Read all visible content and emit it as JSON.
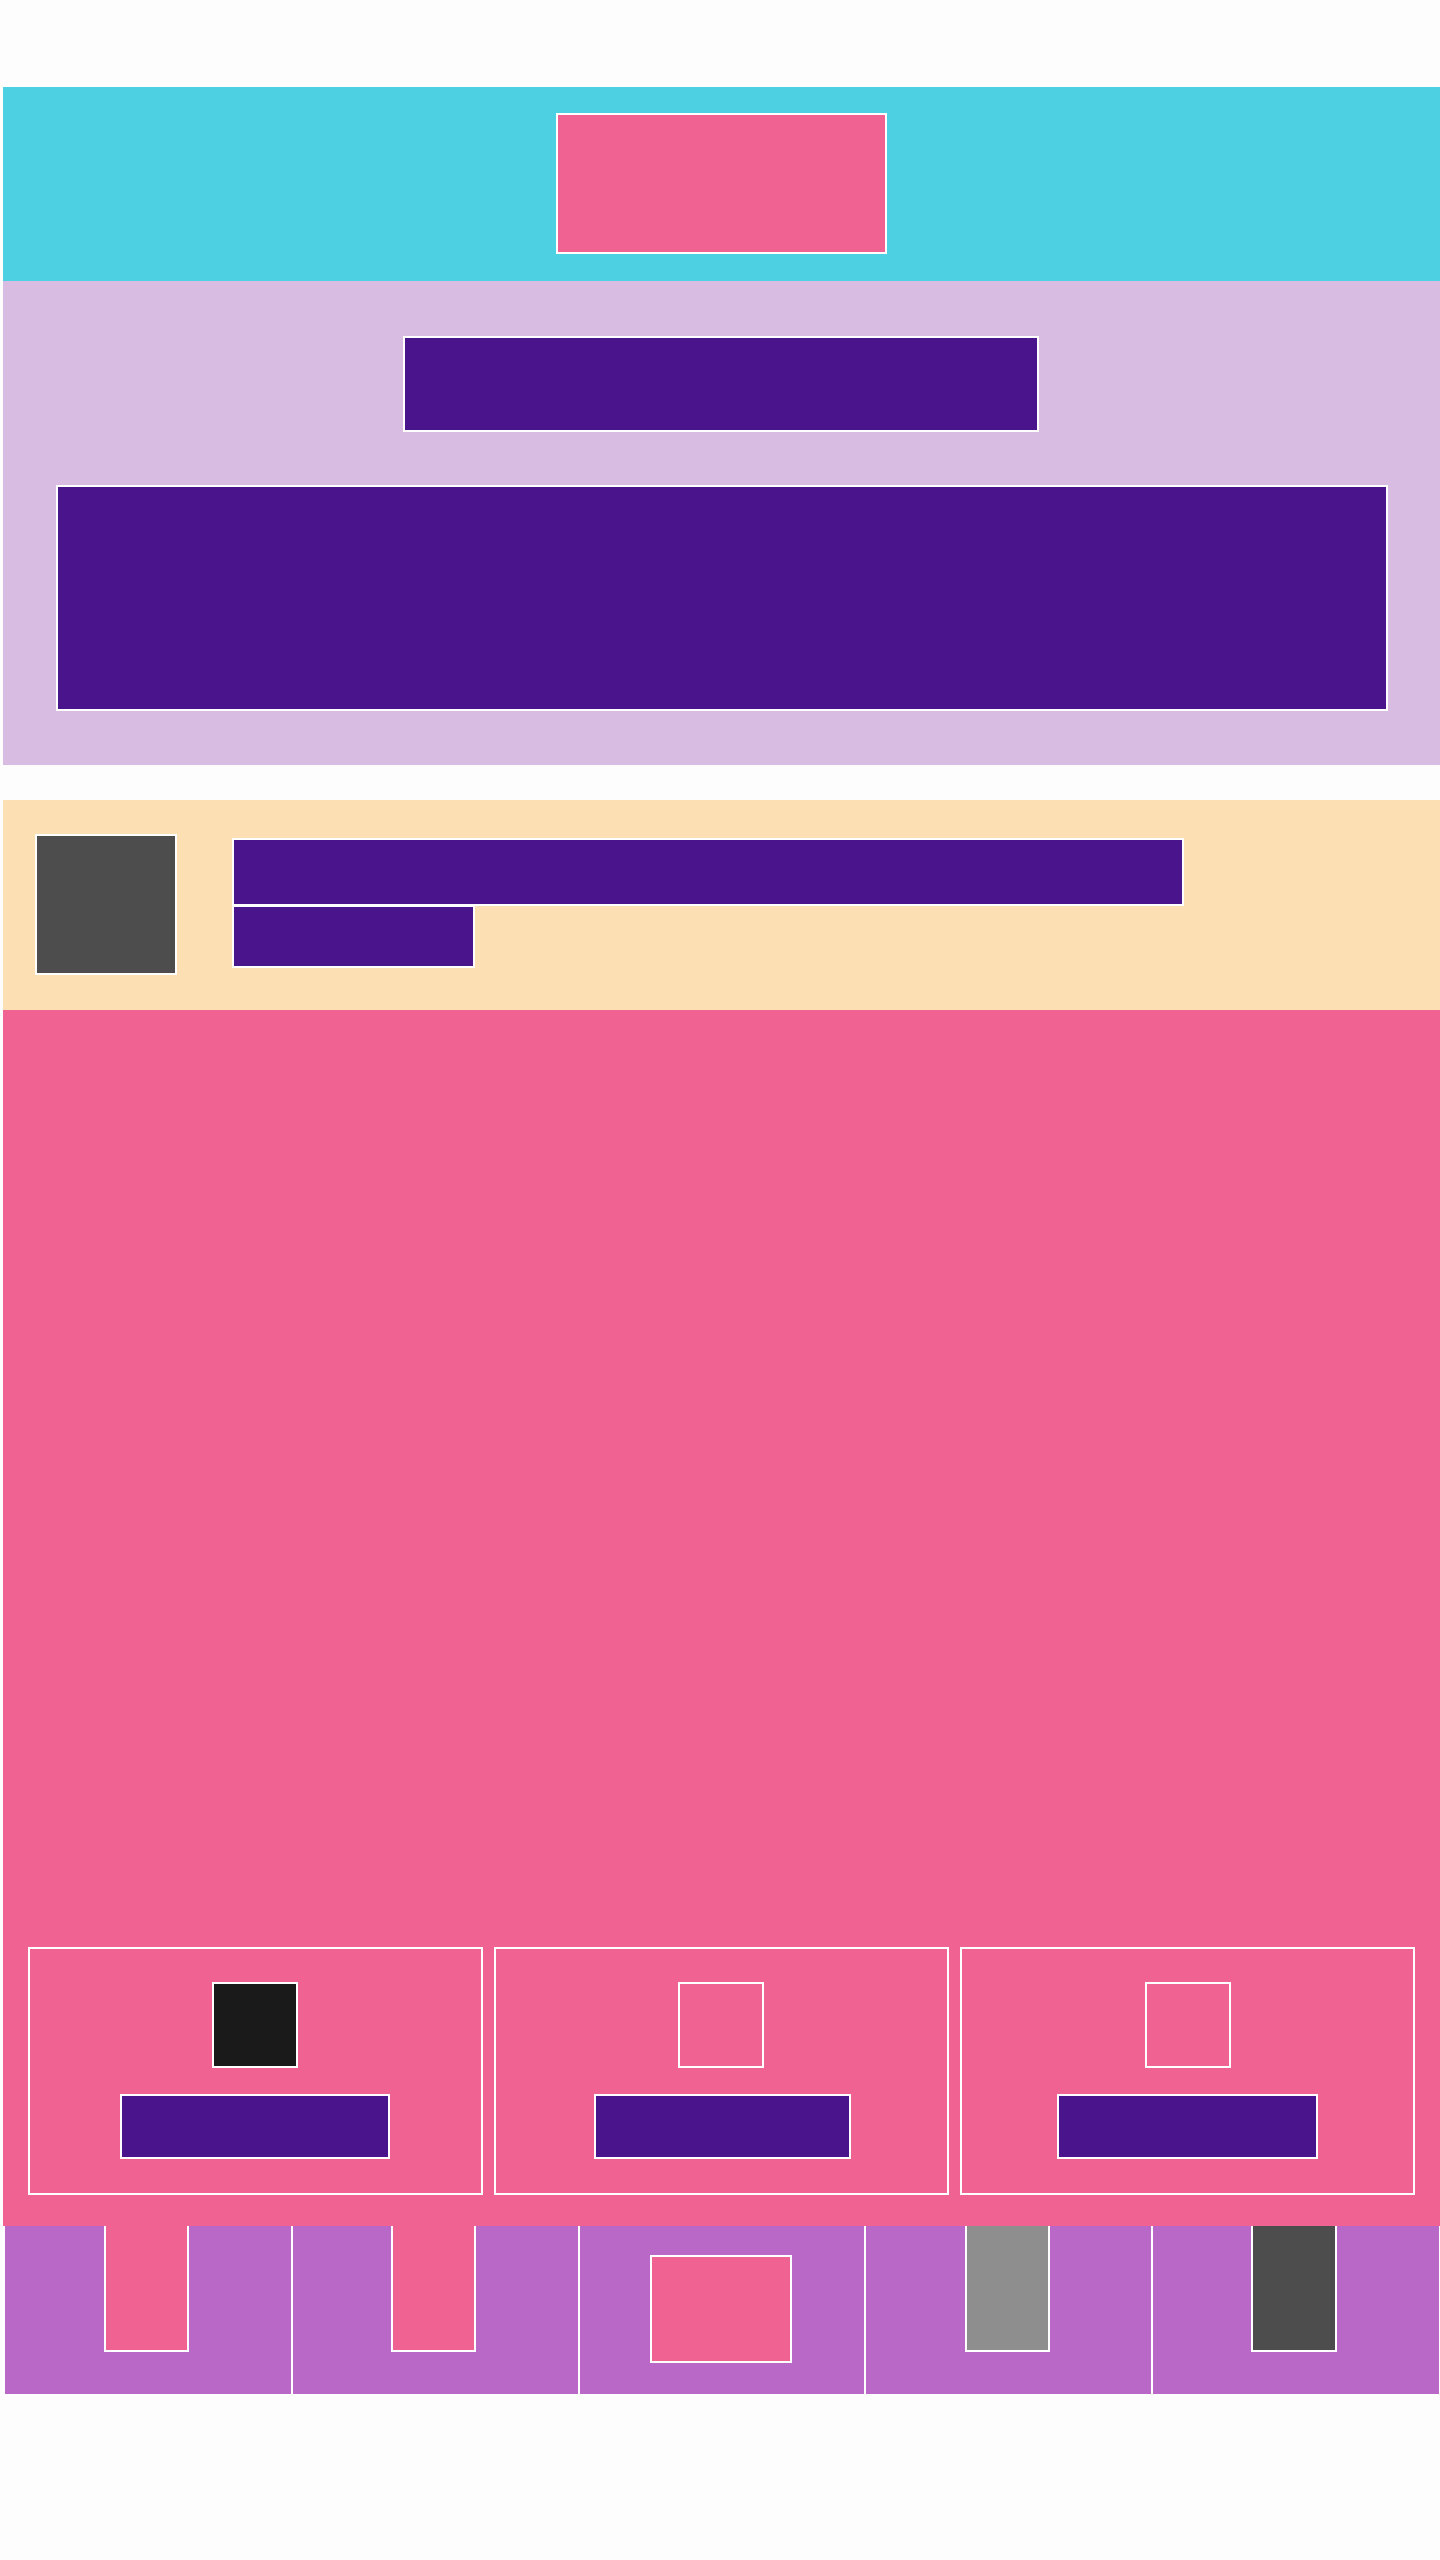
{
  "header": {
    "logo_icon": "logo-placeholder",
    "colors": {
      "background": "#4dd0e1",
      "logo": "#f06292"
    }
  },
  "hero": {
    "title_placeholder": "redacted-title-block",
    "body_placeholder": "redacted-body-block",
    "colors": {
      "background": "#d8bce2",
      "text_block": "#4a148c"
    }
  },
  "profile": {
    "avatar_icon": "avatar-placeholder",
    "colors": {
      "background": "#fddfb4",
      "avatar": "#4d4d4d",
      "text_block": "#4a148c"
    }
  },
  "main": {
    "colors": {
      "background": "#f06292"
    },
    "cards": [
      {
        "icon": "filled-square-icon",
        "icon_color": "#1a1a1a"
      },
      {
        "icon": "outline-square-icon",
        "icon_color": "transparent"
      },
      {
        "icon": "outline-square-icon",
        "icon_color": "transparent"
      }
    ]
  },
  "bottom_nav": {
    "colors": {
      "background": "#ba68c8"
    },
    "items": [
      {
        "icon": "nav-tab-icon",
        "color": "#f06292"
      },
      {
        "icon": "nav-tab-icon",
        "color": "#f06292"
      },
      {
        "icon": "nav-center-icon",
        "color": "#f06292"
      },
      {
        "icon": "nav-tab-icon",
        "color": "#8e8e8e"
      },
      {
        "icon": "nav-tab-icon",
        "color": "#4d4d4d"
      }
    ]
  }
}
